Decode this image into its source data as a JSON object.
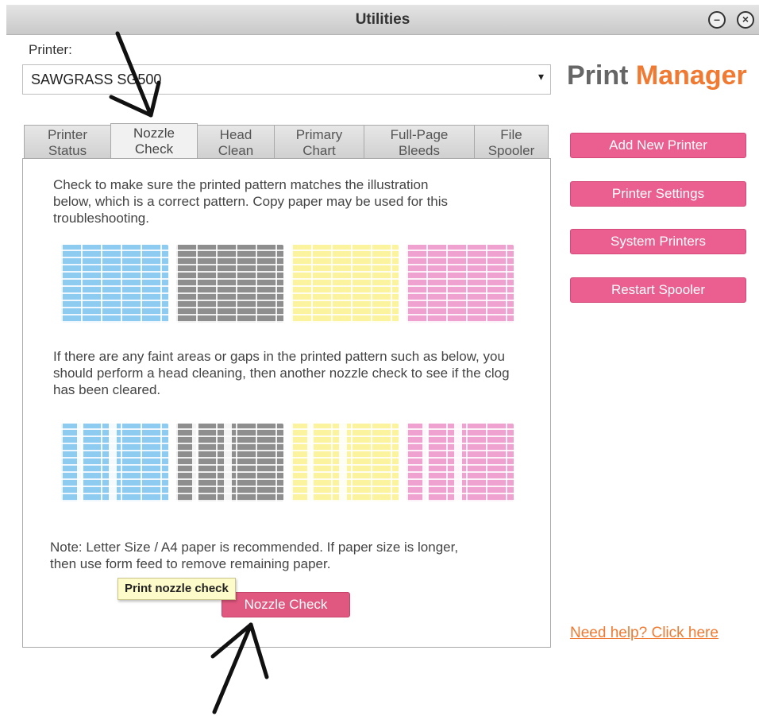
{
  "window": {
    "title": "Utilities",
    "minimize_symbol": "⊖",
    "close_symbol": "⊗"
  },
  "printer": {
    "label": "Printer:",
    "selected": "SAWGRASS SG500"
  },
  "brand": {
    "part1": "Print",
    "part2": "Manager",
    "accent_color": "#f07a32"
  },
  "tabs": [
    {
      "label": "Printer\nStatus"
    },
    {
      "label": "Nozzle\nCheck",
      "active": true
    },
    {
      "label": "Head\nClean"
    },
    {
      "label": "Primary\nChart"
    },
    {
      "label": "Full-Page\nBleeds"
    },
    {
      "label": "File\nSpooler"
    }
  ],
  "panel": {
    "intro": "Check to make sure the printed pattern matches the illustration below, which is a correct pattern. Copy paper may be used for this troubleshooting.",
    "faint": "If there are any faint areas or gaps in the printed pattern such as below, you should perform a head cleaning, then another nozzle check to see if the clog has been cleared.",
    "note": "Note: Letter Size / A4 paper is recommended.  If paper size is longer, then use form feed to remove remaining paper.",
    "tooltip": "Print nozzle check",
    "button": "Nozzle Check",
    "pattern_colors": [
      "cyan",
      "black",
      "yellow",
      "magenta"
    ]
  },
  "sidebar": {
    "buttons": [
      "Add New Printer",
      "Printer Settings",
      "System Printers",
      "Restart Spooler"
    ],
    "button_color": "#ea5f8f",
    "help_link": "Need help? Click here"
  }
}
